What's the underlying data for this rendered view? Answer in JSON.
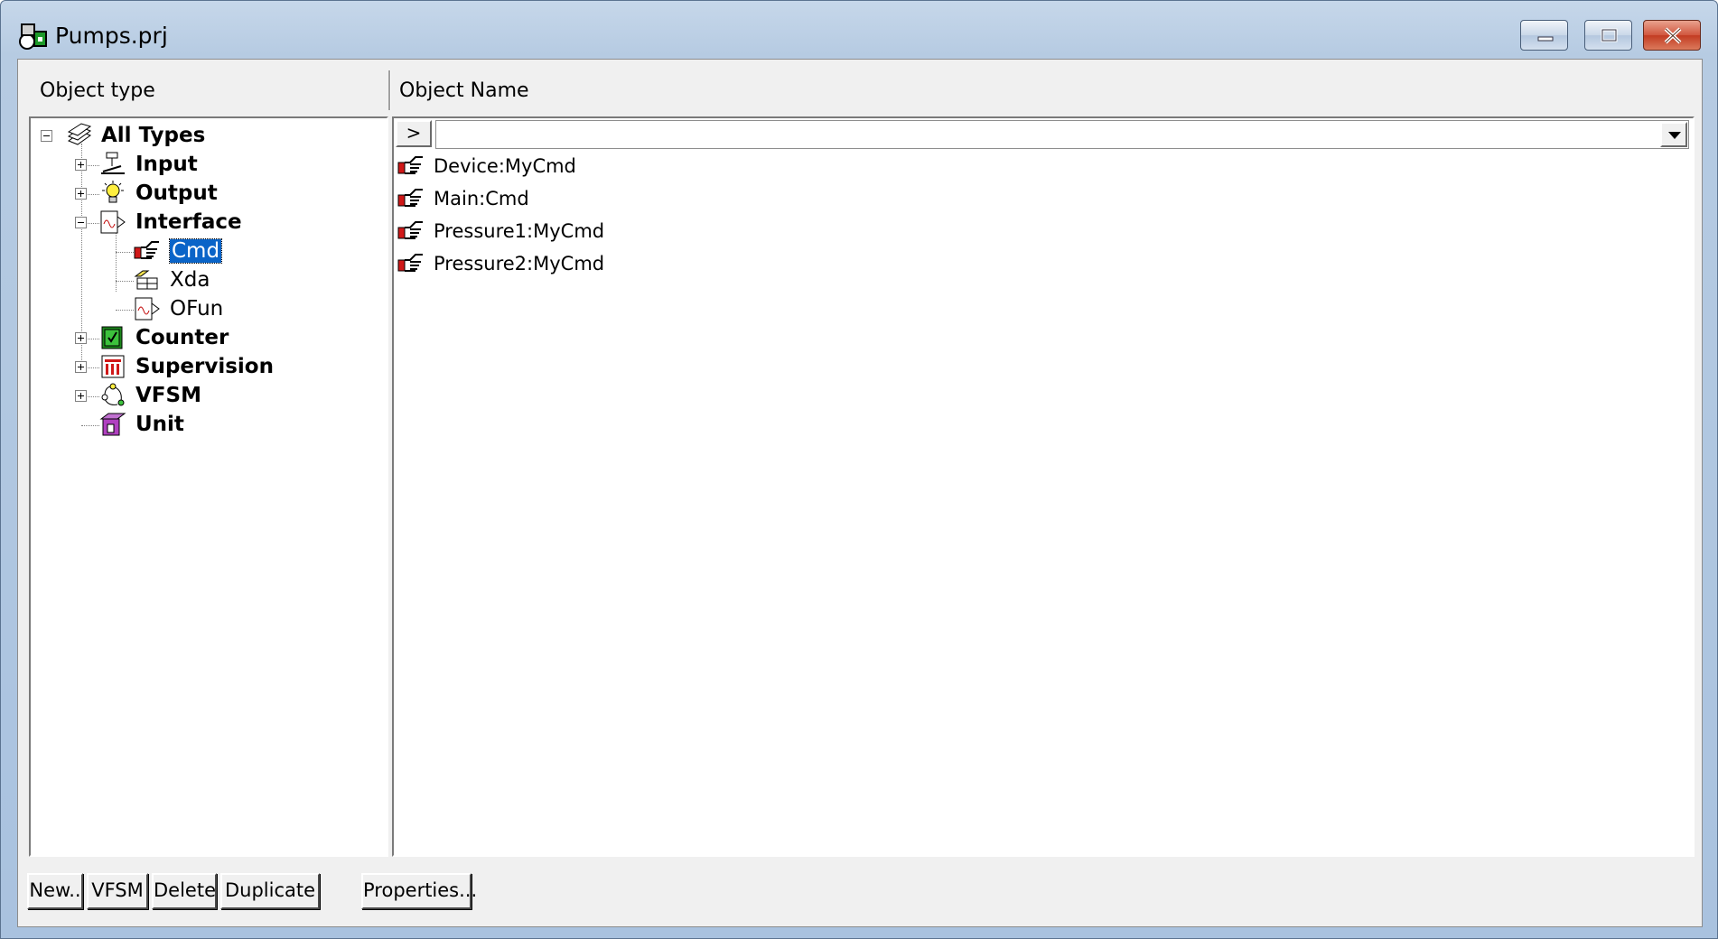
{
  "window": {
    "title": "Pumps.prj",
    "minimize_label": "minimize",
    "maximize_label": "maximize",
    "close_label": "close"
  },
  "headers": {
    "left": "Object type",
    "right": "Object Name"
  },
  "tree": {
    "root": "All Types",
    "input": "Input",
    "output": "Output",
    "interface": "Interface",
    "cmd": "Cmd",
    "xda": "Xda",
    "ofun": "OFun",
    "counter": "Counter",
    "supervision": "Supervision",
    "vfsm": "VFSM",
    "unit": "Unit"
  },
  "filter": {
    "go_label": ">",
    "value": ""
  },
  "objects": [
    "Device:MyCmd",
    "Main:Cmd",
    "Pressure1:MyCmd",
    "Pressure2:MyCmd"
  ],
  "buttons": {
    "new": "New..",
    "vfsm": "VFSM",
    "delete": "Delete",
    "duplicate": "Duplicate",
    "properties": "Properties..."
  }
}
